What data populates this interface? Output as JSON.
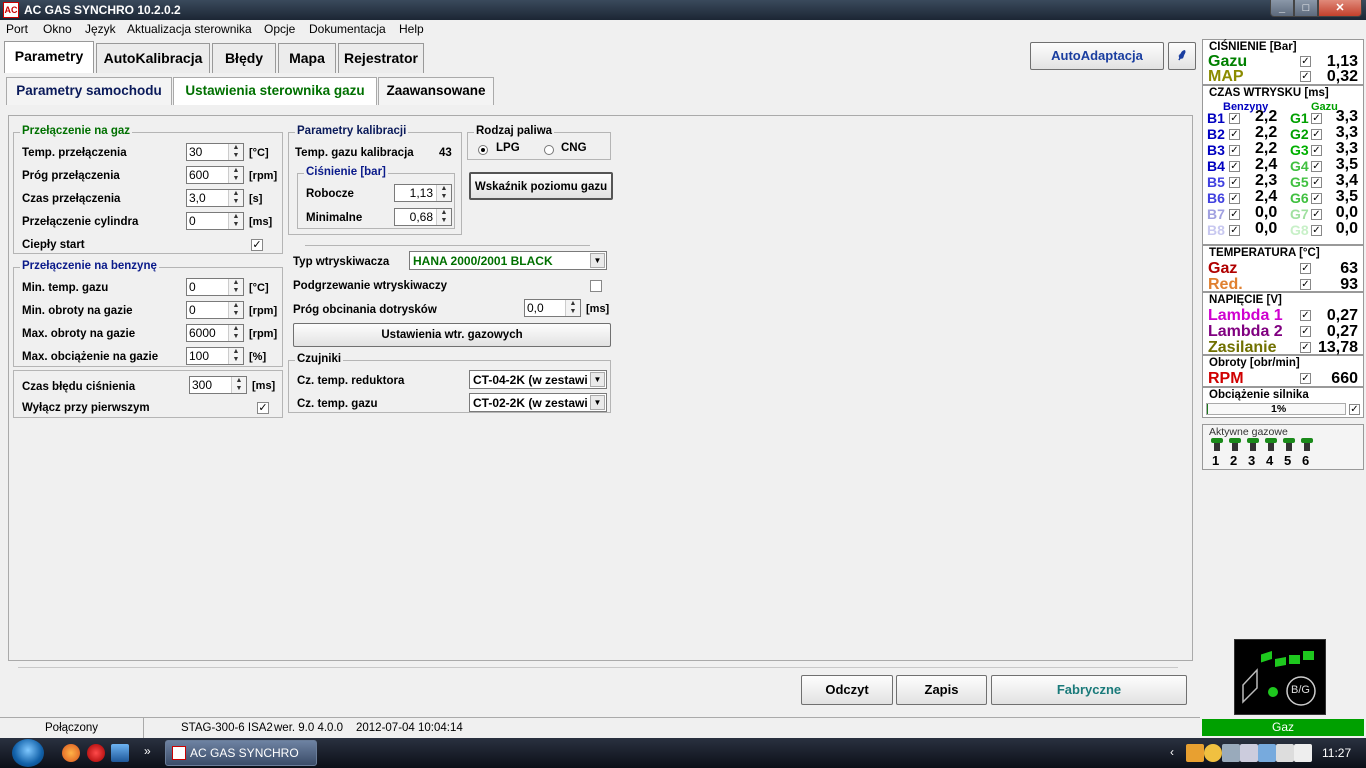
{
  "window": {
    "title": "AC GAS SYNCHRO  10.2.0.2",
    "icon": "app-logo-icon"
  },
  "menu": [
    "Port",
    "Okno",
    "Język",
    "Aktualizacja sterownika",
    "Opcje",
    "Dokumentacja",
    "Help"
  ],
  "tabs": [
    "Parametry",
    "AutoKalibracja",
    "Błędy",
    "Mapa",
    "Rejestrator"
  ],
  "autoadapt_label": "AutoAdaptacja",
  "subtabs": [
    "Parametry samochodu",
    "Ustawienia sterownika gazu",
    "Zaawansowane"
  ],
  "switch_to_gas": {
    "title": "Przełączenie na gaz",
    "rows": [
      {
        "label": "Temp. przełączenia",
        "value": "30",
        "unit": "[°C]"
      },
      {
        "label": "Próg przełączenia",
        "value": "600",
        "unit": "[rpm]"
      },
      {
        "label": "Czas przełączenia",
        "value": "3,0",
        "unit": "[s]"
      },
      {
        "label": "Przełączenie cylindra",
        "value": "0",
        "unit": "[ms]"
      }
    ],
    "warm_start_label": "Ciepły start",
    "warm_start_checked": true
  },
  "switch_to_petrol": {
    "title": "Przełączenie na benzynę",
    "rows": [
      {
        "label": "Min. temp. gazu",
        "value": "0",
        "unit": "[°C]"
      },
      {
        "label": "Min. obroty na gazie",
        "value": "0",
        "unit": "[rpm]"
      },
      {
        "label": "Max. obroty na gazie",
        "value": "6000",
        "unit": "[rpm]"
      },
      {
        "label": "Max. obciążenie na gazie",
        "value": "100",
        "unit": "[%]"
      }
    ]
  },
  "pressure_error": {
    "label": "Czas błędu ciśnienia",
    "value": "300",
    "unit": "[ms]",
    "first_off_label": "Wyłącz przy pierwszym",
    "first_off_checked": true
  },
  "calibration": {
    "title": "Parametry kalibracji",
    "temp_label": "Temp. gazu kalibracja",
    "temp_value": "43",
    "pressure_title": "Ciśnienie [bar]",
    "working_label": "Robocze",
    "working_value": "1,13",
    "minimal_label": "Minimalne",
    "minimal_value": "0,68"
  },
  "fuel": {
    "title": "Rodzaj paliwa",
    "lpg": "LPG",
    "cng": "CNG",
    "selected": "LPG"
  },
  "gas_level_button": "Wskaźnik poziomu gazu",
  "injector": {
    "type_label": "Typ wtryskiwacza",
    "type_value": "HANA 2000/2001 BLACK",
    "heating_label": "Podgrzewanie wtryskiwaczy",
    "heating_checked": false,
    "cutoff_label": "Próg obcinania dotrysków",
    "cutoff_value": "0,0",
    "cutoff_unit": "[ms]",
    "settings_button": "Ustawienia wtr. gazowych"
  },
  "sensors": {
    "title": "Czujniki",
    "reducer_label": "Cz. temp. reduktora",
    "reducer_value": "CT-04-2K (w zestawi",
    "gas_label": "Cz. temp. gazu",
    "gas_value": "CT-02-2K (w zestawi"
  },
  "bottom_buttons": {
    "read": "Odczyt",
    "save": "Zapis",
    "factory": "Fabryczne"
  },
  "status": {
    "connection": "Połączony",
    "device": "STAG-300-6 ISA2",
    "version": "wer. 9.0  4.0.0",
    "date": "2012-07-04 10:04:14"
  },
  "right": {
    "pressure": {
      "title": "CIŚNIENIE [Bar]",
      "gas_label": "Gazu",
      "gas_value": "1,13",
      "map_label": "MAP",
      "map_value": "0,32"
    },
    "injection": {
      "title": "CZAS WTRYSKU  [ms]",
      "petrol_head": "Benzyny",
      "gas_head": "Gazu",
      "rows": [
        {
          "b": "B1",
          "bv": "2,2",
          "g": "G1",
          "gv": "3,3"
        },
        {
          "b": "B2",
          "bv": "2,2",
          "g": "G2",
          "gv": "3,3"
        },
        {
          "b": "B3",
          "bv": "2,2",
          "g": "G3",
          "gv": "3,3"
        },
        {
          "b": "B4",
          "bv": "2,4",
          "g": "G4",
          "gv": "3,5"
        },
        {
          "b": "B5",
          "bv": "2,3",
          "g": "G5",
          "gv": "3,4"
        },
        {
          "b": "B6",
          "bv": "2,4",
          "g": "G6",
          "gv": "3,5"
        },
        {
          "b": "B7",
          "bv": "0,0",
          "g": "G7",
          "gv": "0,0"
        },
        {
          "b": "B8",
          "bv": "0,0",
          "g": "G8",
          "gv": "0,0"
        }
      ]
    },
    "temperature": {
      "title": "TEMPERATURA  [°C]",
      "gas_label": "Gaz",
      "gas_value": "63",
      "red_label": "Red.",
      "red_value": "93"
    },
    "voltage": {
      "title": "NAPIĘCIE [V]",
      "l1_label": "Lambda 1",
      "l1_value": "0,27",
      "l2_label": "Lambda 2",
      "l2_value": "0,27",
      "sup_label": "Zasilanie",
      "sup_value": "13,78"
    },
    "rpm": {
      "title": "Obroty [obr/min]",
      "label": "RPM",
      "value": "660"
    },
    "load": {
      "title": "Obciążenie silnika",
      "value": "1%"
    },
    "active": {
      "title": "Aktywne gazowe",
      "numbers": [
        "1",
        "2",
        "3",
        "4",
        "5",
        "6"
      ]
    },
    "bg_button": "B/G",
    "mode": "Gaz"
  },
  "taskbar": {
    "task": "AC GAS SYNCHRO",
    "clock": "11:27"
  },
  "colors": {
    "gas_green": "#008000",
    "map_olive": "#8b8b00",
    "petrol_blue": "#0000c0",
    "gas_bright": "#00a000",
    "red": "#d00000",
    "orange": "#e07820",
    "magenta": "#d000d0",
    "purple": "#800080",
    "olive": "#707000",
    "mode_bg": "#00a000"
  }
}
